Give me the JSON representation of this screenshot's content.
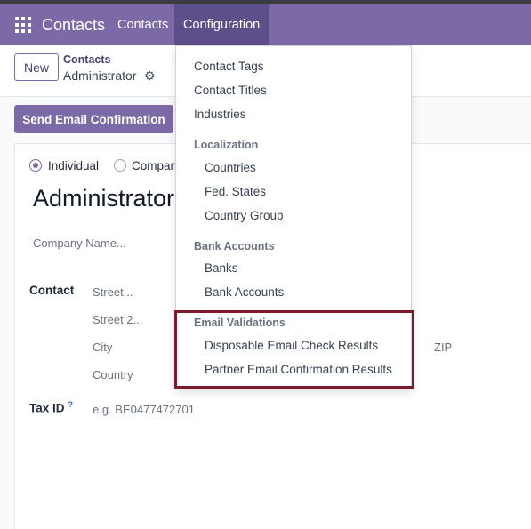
{
  "navbar": {
    "app_name": "Contacts",
    "items": [
      {
        "label": "Contacts"
      },
      {
        "label": "Configuration"
      }
    ]
  },
  "control": {
    "new_label": "New",
    "breadcrumb_parent": "Contacts",
    "breadcrumb_current": "Administrator"
  },
  "actions": {
    "send_email_confirmation": "Send Email Confirmation"
  },
  "form": {
    "radio_individual": "Individual",
    "radio_company": "Compan",
    "name": "Administrator",
    "company_name_placeholder": "Company Name...",
    "contact_label": "Contact",
    "street_placeholder": "Street...",
    "street2_placeholder": "Street 2...",
    "city_placeholder": "City",
    "zip_placeholder": "ZIP",
    "country_placeholder": "Country",
    "tax_id_label": "Tax ID",
    "tax_id_help": "?",
    "tax_id_placeholder": "e.g. BE0477472701"
  },
  "dropdown": {
    "items": [
      {
        "label": "Contact Tags"
      },
      {
        "label": "Contact Titles"
      },
      {
        "label": "Industries"
      }
    ],
    "localization_header": "Localization",
    "localization_items": [
      {
        "label": "Countries"
      },
      {
        "label": "Fed. States"
      },
      {
        "label": "Country Group"
      }
    ],
    "bank_header": "Bank Accounts",
    "bank_items": [
      {
        "label": "Banks"
      },
      {
        "label": "Bank Accounts"
      }
    ],
    "email_header": "Email Validations",
    "email_items": [
      {
        "label": "Disposable Email Check Results"
      },
      {
        "label": "Partner Email Confirmation Results"
      }
    ]
  },
  "colors": {
    "navbar": "#7c6aa6",
    "highlight_box": "#7e1a2a"
  }
}
